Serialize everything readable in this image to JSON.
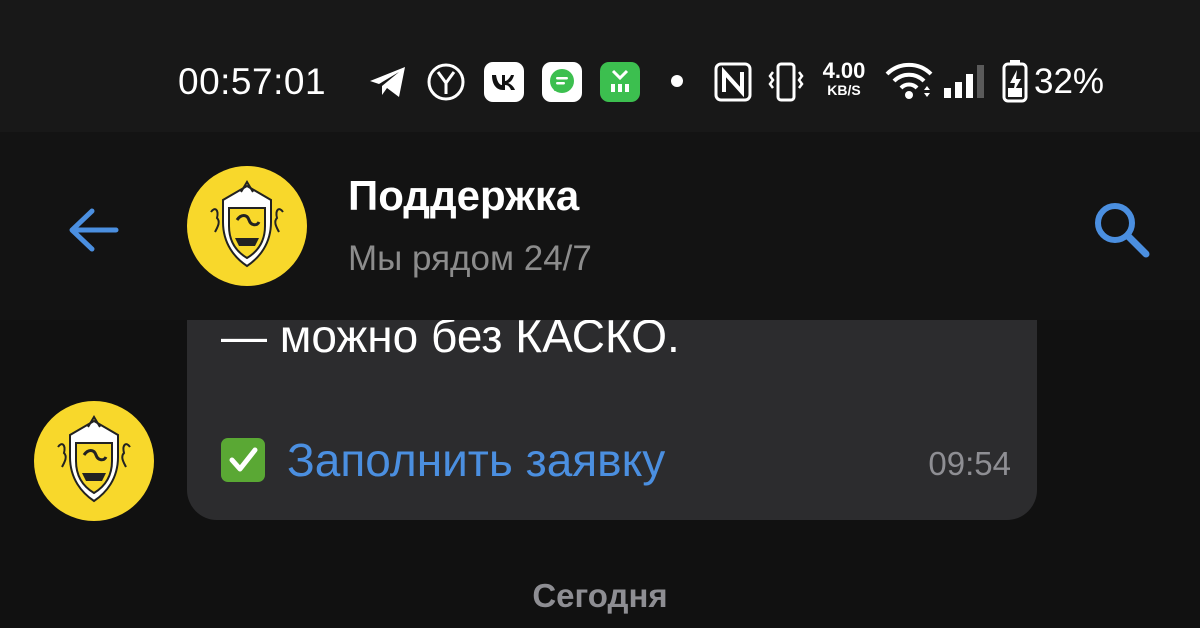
{
  "status_bar": {
    "time": "00:57:01",
    "net_speed_value": "4.00",
    "net_speed_unit": "KB/S",
    "battery_percent": "32%",
    "icons": [
      "telegram-icon",
      "yandex-icon",
      "vk-icon",
      "messenger-icon",
      "app-icon",
      "dot-icon",
      "nfc-icon",
      "vibrate-icon",
      "wifi-icon",
      "signal-icon",
      "battery-charging-icon"
    ]
  },
  "header": {
    "title": "Поддержка",
    "subtitle": "Мы рядом 24/7",
    "back_icon": "arrow-left-icon",
    "search_icon": "search-icon"
  },
  "messages": [
    {
      "text": "— можно без КАСКО.",
      "link_emoji": "✅",
      "link_text": "Заполнить заявку",
      "time": "09:54"
    }
  ],
  "date_separator": "Сегодня",
  "colors": {
    "background": "#111111",
    "bubble": "#2c2c2e",
    "accent": "#4b8fe0",
    "avatar": "#f8d82b",
    "muted": "#8e8e93"
  }
}
